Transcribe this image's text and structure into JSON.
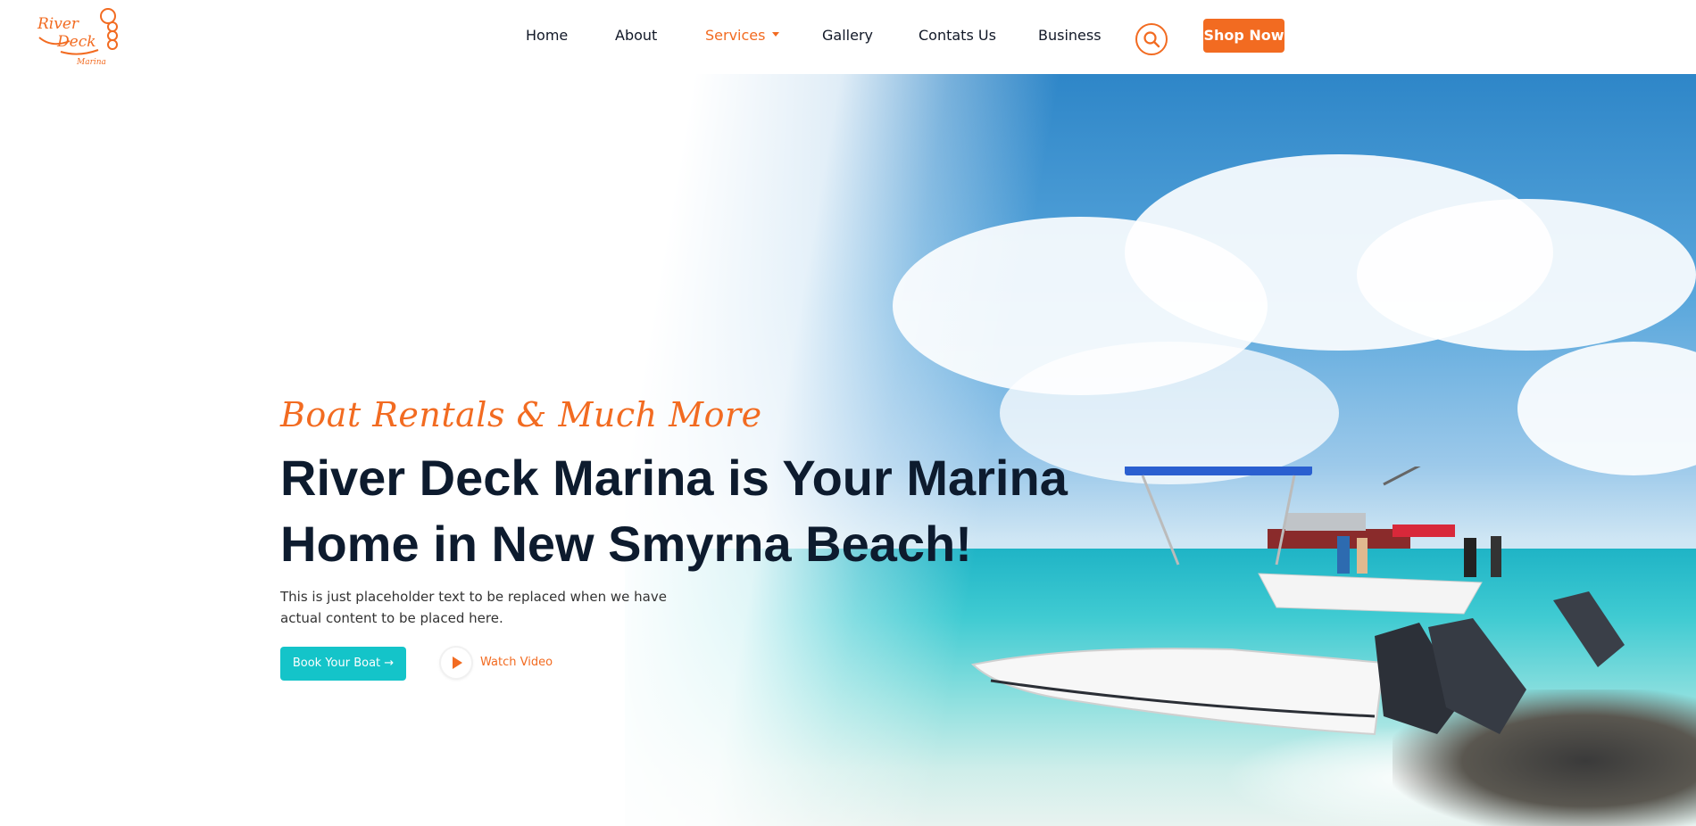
{
  "brand": {
    "logo_text_1": "River",
    "logo_text_2": "Deck",
    "logo_text_3": "Marina",
    "accent_color": "#f26b21",
    "teal_color": "#14c4c9",
    "heading_color": "#0d1b2e"
  },
  "nav": {
    "items": [
      {
        "label": "Home"
      },
      {
        "label": "About"
      },
      {
        "label": "Services",
        "active": true,
        "has_dropdown": true
      },
      {
        "label": "Gallery"
      },
      {
        "label": "Contats Us"
      },
      {
        "label": "Business"
      }
    ],
    "search_icon": "search-icon",
    "shop_label": "Shop Now"
  },
  "hero": {
    "tagline": "Boat Rentals & Much More",
    "headline_line1": "River Deck Marina is Your Marina",
    "headline_line2": "Home in New Smyrna Beach!",
    "subtext": "This is just placeholder text to be replaced when we have actual content to be placed here.",
    "book_label": "Book Your Boat →",
    "watch_label": "Watch Video",
    "image_description_icon": "boats-on-beach-photo"
  }
}
